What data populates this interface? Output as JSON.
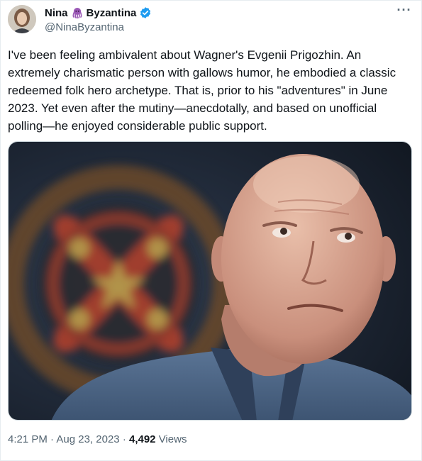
{
  "author": {
    "name_part1": "Nina",
    "name_emoji": "octopus-emoji",
    "name_part2": "Byzantina",
    "handle": "@NinaByzantina",
    "verified": true
  },
  "tweet": {
    "text": "I've been feeling ambivalent about Wagner's Evgenii Prigozhin. An\nextremely charismatic person with gallows humor, he embodied a classic\nredeemed folk hero archetype. That is, prior to his \"adventures\" in June\n2023. Yet even after the mutiny—anecdotally, and based on unofficial\npolling—he enjoyed considerable public support.",
    "time": "4:21 PM",
    "date": "Aug 23, 2023",
    "separator": "·",
    "views_count": "4,492",
    "views_label": "Views"
  },
  "icons": {
    "more": "more-options-icon",
    "verified": "verified-badge-icon"
  },
  "colors": {
    "verified_blue": "#1d9bf0",
    "secondary_text": "#536471",
    "primary_text": "#0f1419",
    "octopus_purple": "#9b59b6"
  }
}
